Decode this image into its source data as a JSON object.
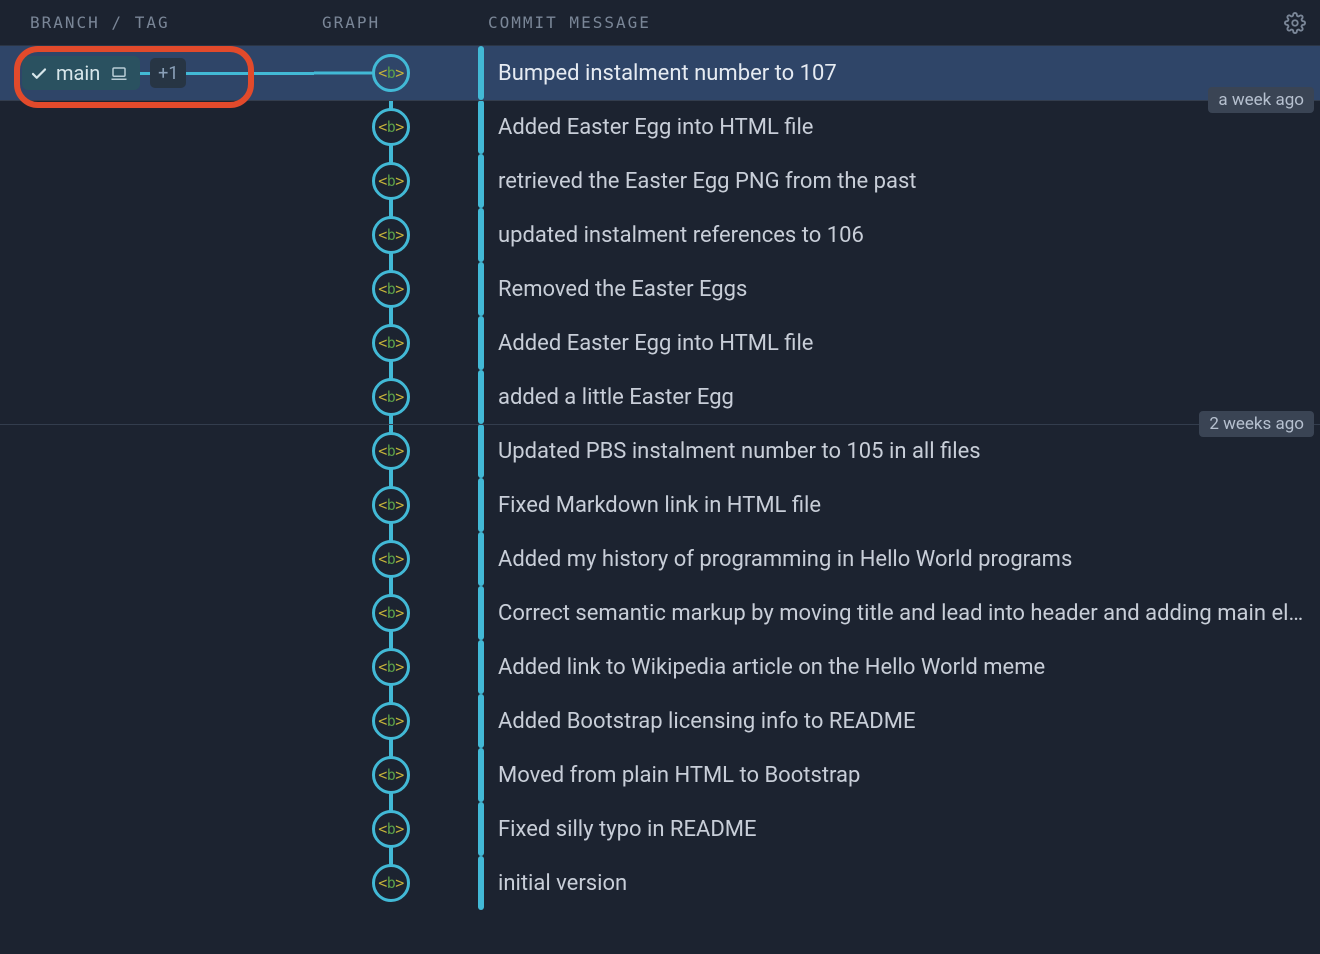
{
  "headers": {
    "branch_tag": "BRANCH / TAG",
    "graph": "GRAPH",
    "commit_message": "COMMIT MESSAGE"
  },
  "branch_pill": {
    "name": "main",
    "extra_count": "+1"
  },
  "avatar_glyph": {
    "open": "<",
    "letter": "b",
    "close": ">"
  },
  "time_separators": [
    {
      "label": "a week ago",
      "before_index": 1
    },
    {
      "label": "2 weeks ago",
      "before_index": 7
    }
  ],
  "commits": [
    {
      "message": "Bumped instalment number to 107",
      "selected": true
    },
    {
      "message": "Added Easter Egg into HTML file"
    },
    {
      "message": "retrieved the Easter Egg PNG from the past"
    },
    {
      "message": "updated instalment references to 106"
    },
    {
      "message": "Removed the Easter Eggs"
    },
    {
      "message": "Added Easter Egg into HTML file"
    },
    {
      "message": "added a little Easter Egg"
    },
    {
      "message": "Updated PBS instalment number to 105 in all files"
    },
    {
      "message": "Fixed Markdown link in HTML file"
    },
    {
      "message": "Added my history of programming in Hello World programs"
    },
    {
      "message": "Correct semantic markup by moving title and lead into header and adding main element"
    },
    {
      "message": "Added link to Wikipedia article on the Hello World meme"
    },
    {
      "message": "Added Bootstrap licensing info to README"
    },
    {
      "message": "Moved from plain HTML to Bootstrap"
    },
    {
      "message": "Fixed silly typo in README"
    },
    {
      "message": "initial version"
    }
  ]
}
